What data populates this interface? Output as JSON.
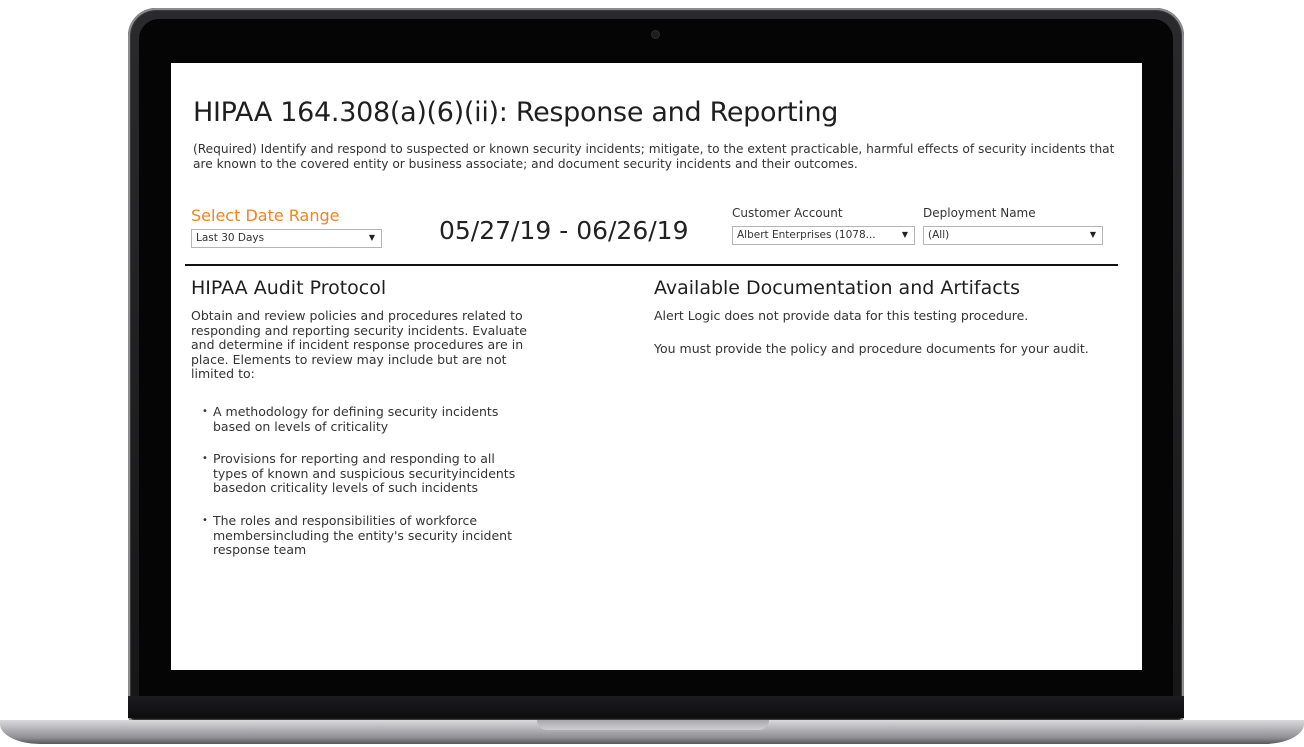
{
  "page": {
    "title": "HIPAA 164.308(a)(6)(ii): Response and Reporting",
    "description": "(Required) Identify and respond to suspected or known security incidents; mitigate, to the extent practicable, harmful effects of security incidents that are known to the covered entity or business associate; and document security incidents and their outcomes."
  },
  "filters": {
    "date_range_label": "Select Date Range",
    "date_range_value": "Last 30 Days",
    "date_display": "05/27/19 - 06/26/19",
    "customer_label": "Customer Account",
    "customer_value": "Albert Enterprises (1078...",
    "deployment_label": "Deployment Name",
    "deployment_value": "(All)"
  },
  "audit_protocol": {
    "heading": "HIPAA Audit Protocol",
    "intro": "Obtain and review policies and procedures related to responding and reporting security incidents. Evaluate and determine if incident response procedures are in place. Elements to review may include but are not limited to:",
    "bullets": [
      "A methodology for defining security incidents based on levels of criticality",
      "Provisions for reporting and responding to all types of known and suspicious securityincidents basedon criticality levels of such incidents",
      "The roles and responsibilities of workforce membersincluding the entity's security incident response team"
    ]
  },
  "documentation": {
    "heading": "Available Documentation and Artifacts",
    "paragraph1": "Alert Logic does not provide data for this testing procedure.",
    "paragraph2": "You must provide the policy and procedure documents for your audit."
  },
  "colors": {
    "accent": "#f58220",
    "text": "#333333"
  },
  "icons": {
    "dropdown": "caret-down-icon"
  }
}
